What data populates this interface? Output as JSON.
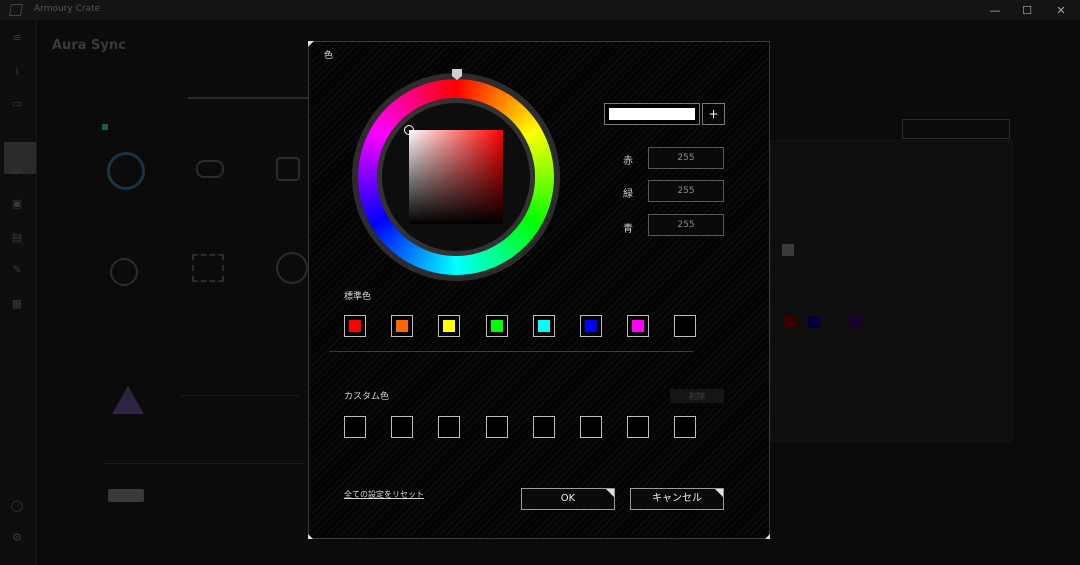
{
  "app": {
    "title": "Armoury Crate",
    "page_title": "Aura Sync",
    "window_controls": {
      "minimize": "—",
      "maximize": "☐",
      "close": "✕"
    }
  },
  "dialog": {
    "title": "色",
    "add_button": "+",
    "preview_color": "#ffffff",
    "rgb": [
      {
        "label": "赤",
        "value": "255"
      },
      {
        "label": "緑",
        "value": "255"
      },
      {
        "label": "青",
        "value": "255"
      }
    ],
    "standard_colors_label": "標準色",
    "standard_colors": [
      "#ff0000",
      "#ff6600",
      "#ffff00",
      "#00ff00",
      "#00ffff",
      "#0000ff",
      "#ff00ff",
      ""
    ],
    "custom_colors_label": "カスタム色",
    "delete_button": "削除",
    "custom_colors": [
      "",
      "",
      "",
      "",
      "",
      "",
      "",
      ""
    ],
    "reset_link": "全ての設定をリセット",
    "ok_button": "OK",
    "cancel_button": "キャンセル"
  },
  "colors": {
    "accent": "#1d5a52",
    "dialog_border": "#3a3a3a"
  }
}
